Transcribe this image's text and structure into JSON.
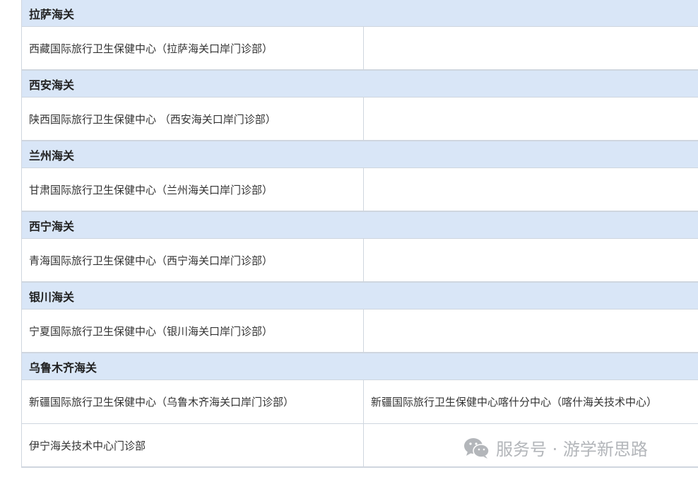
{
  "sections": [
    {
      "header": "拉萨海关",
      "rows": [
        {
          "col1": "西藏国际旅行卫生保健中心（拉萨海关口岸门诊部）",
          "col2": ""
        }
      ]
    },
    {
      "header": "西安海关",
      "rows": [
        {
          "col1": "陕西国际旅行卫生保健中心 （西安海关口岸门诊部）",
          "col2": ""
        }
      ]
    },
    {
      "header": "兰州海关",
      "rows": [
        {
          "col1": "甘肃国际旅行卫生保健中心（兰州海关口岸门诊部）",
          "col2": ""
        }
      ]
    },
    {
      "header": "西宁海关",
      "rows": [
        {
          "col1": "青海国际旅行卫生保健中心（西宁海关口岸门诊部）",
          "col2": ""
        }
      ]
    },
    {
      "header": "银川海关",
      "rows": [
        {
          "col1": "宁夏国际旅行卫生保健中心（银川海关口岸门诊部）",
          "col2": ""
        }
      ]
    },
    {
      "header": "乌鲁木齐海关",
      "rows": [
        {
          "col1": "新疆国际旅行卫生保健中心（乌鲁木齐海关口岸门诊部）",
          "col2": "新疆国际旅行卫生保健中心喀什分中心（喀什海关技术中心）"
        },
        {
          "col1": "伊宁海关技术中心门诊部",
          "col2": ""
        }
      ]
    }
  ],
  "watermark": {
    "text": "服务号 · 游学新思路",
    "icon": "wechat-icon",
    "color": "#b3b6ba"
  }
}
